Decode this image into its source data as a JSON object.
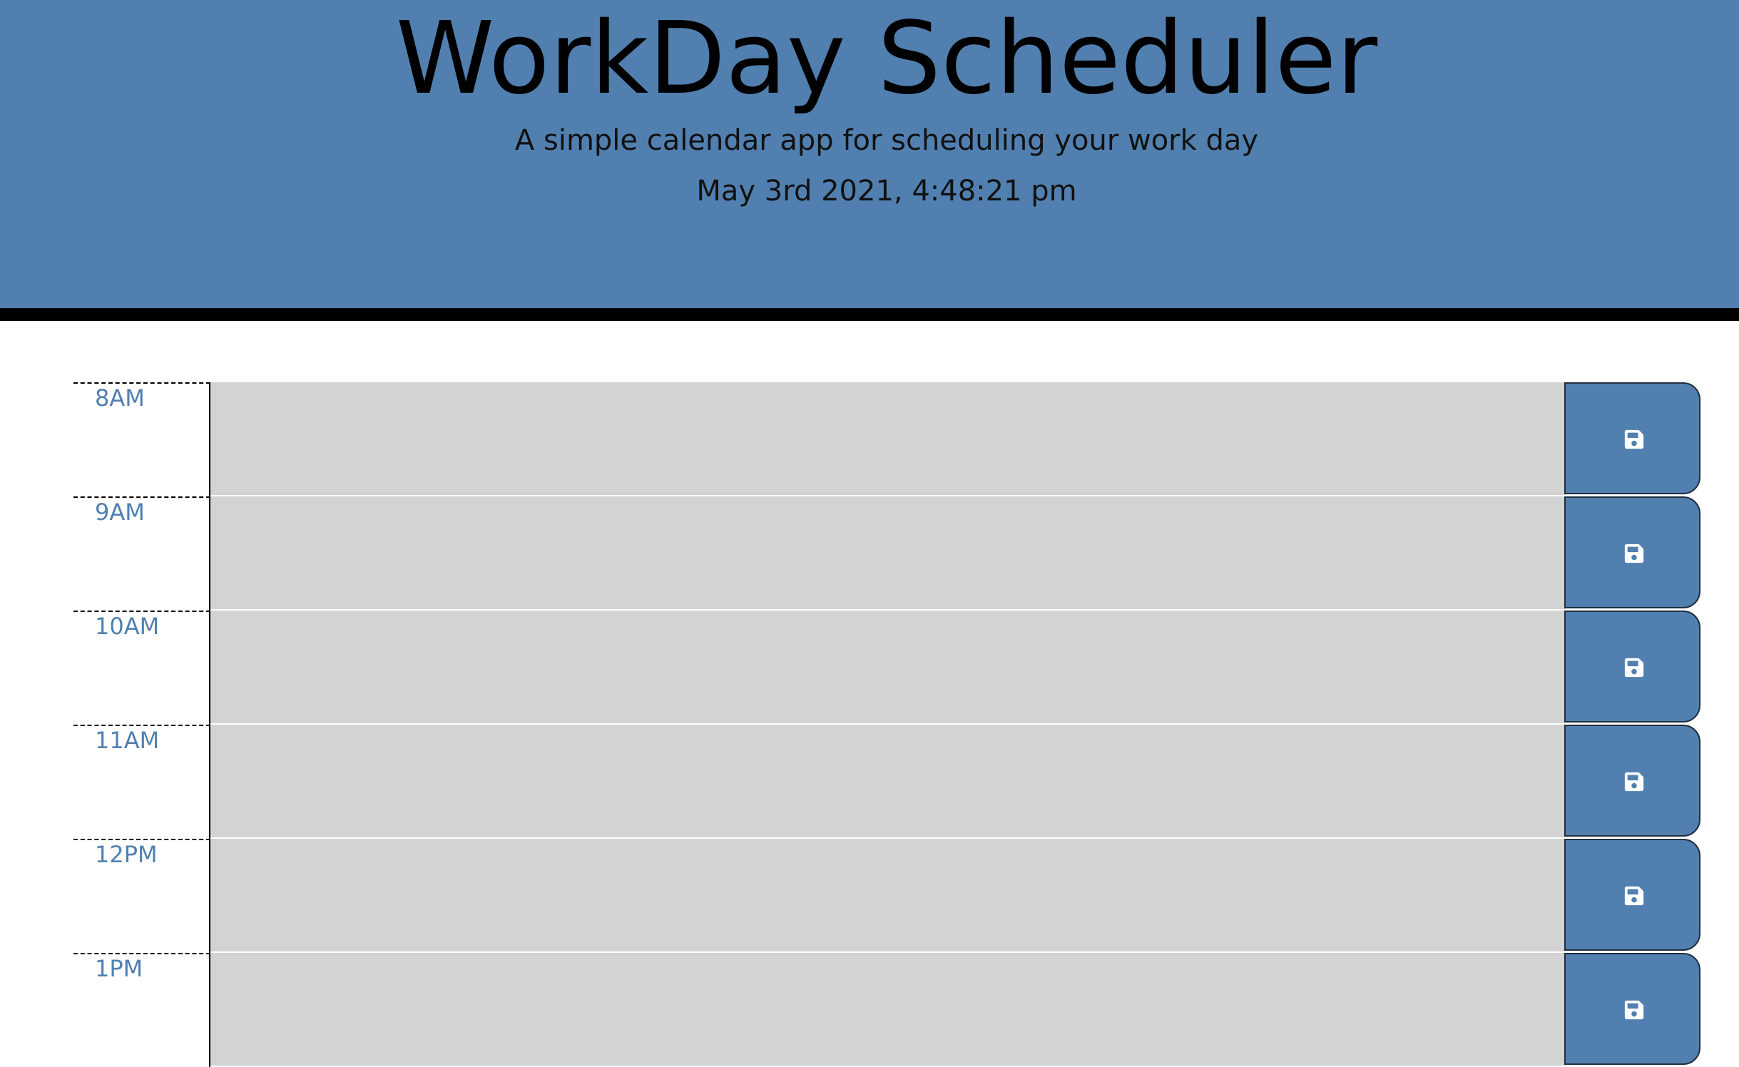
{
  "header": {
    "title": "WorkDay Scheduler",
    "subtitle": "A simple calendar app for scheduling your work day",
    "current_day": "May 3rd 2021, 4:48:21 pm"
  },
  "colors": {
    "header_background": "#5180b0",
    "hour_label": "#5180b0",
    "row_background": "#d3d3d3",
    "save_button": "#5180b0"
  },
  "time_blocks": [
    {
      "hour": "8AM",
      "description": "",
      "save_icon": "save-icon"
    },
    {
      "hour": "9AM",
      "description": "",
      "save_icon": "save-icon"
    },
    {
      "hour": "10AM",
      "description": "",
      "save_icon": "save-icon"
    },
    {
      "hour": "11AM",
      "description": "",
      "save_icon": "save-icon"
    },
    {
      "hour": "12PM",
      "description": "",
      "save_icon": "save-icon"
    },
    {
      "hour": "1PM",
      "description": "",
      "save_icon": "save-icon"
    }
  ]
}
